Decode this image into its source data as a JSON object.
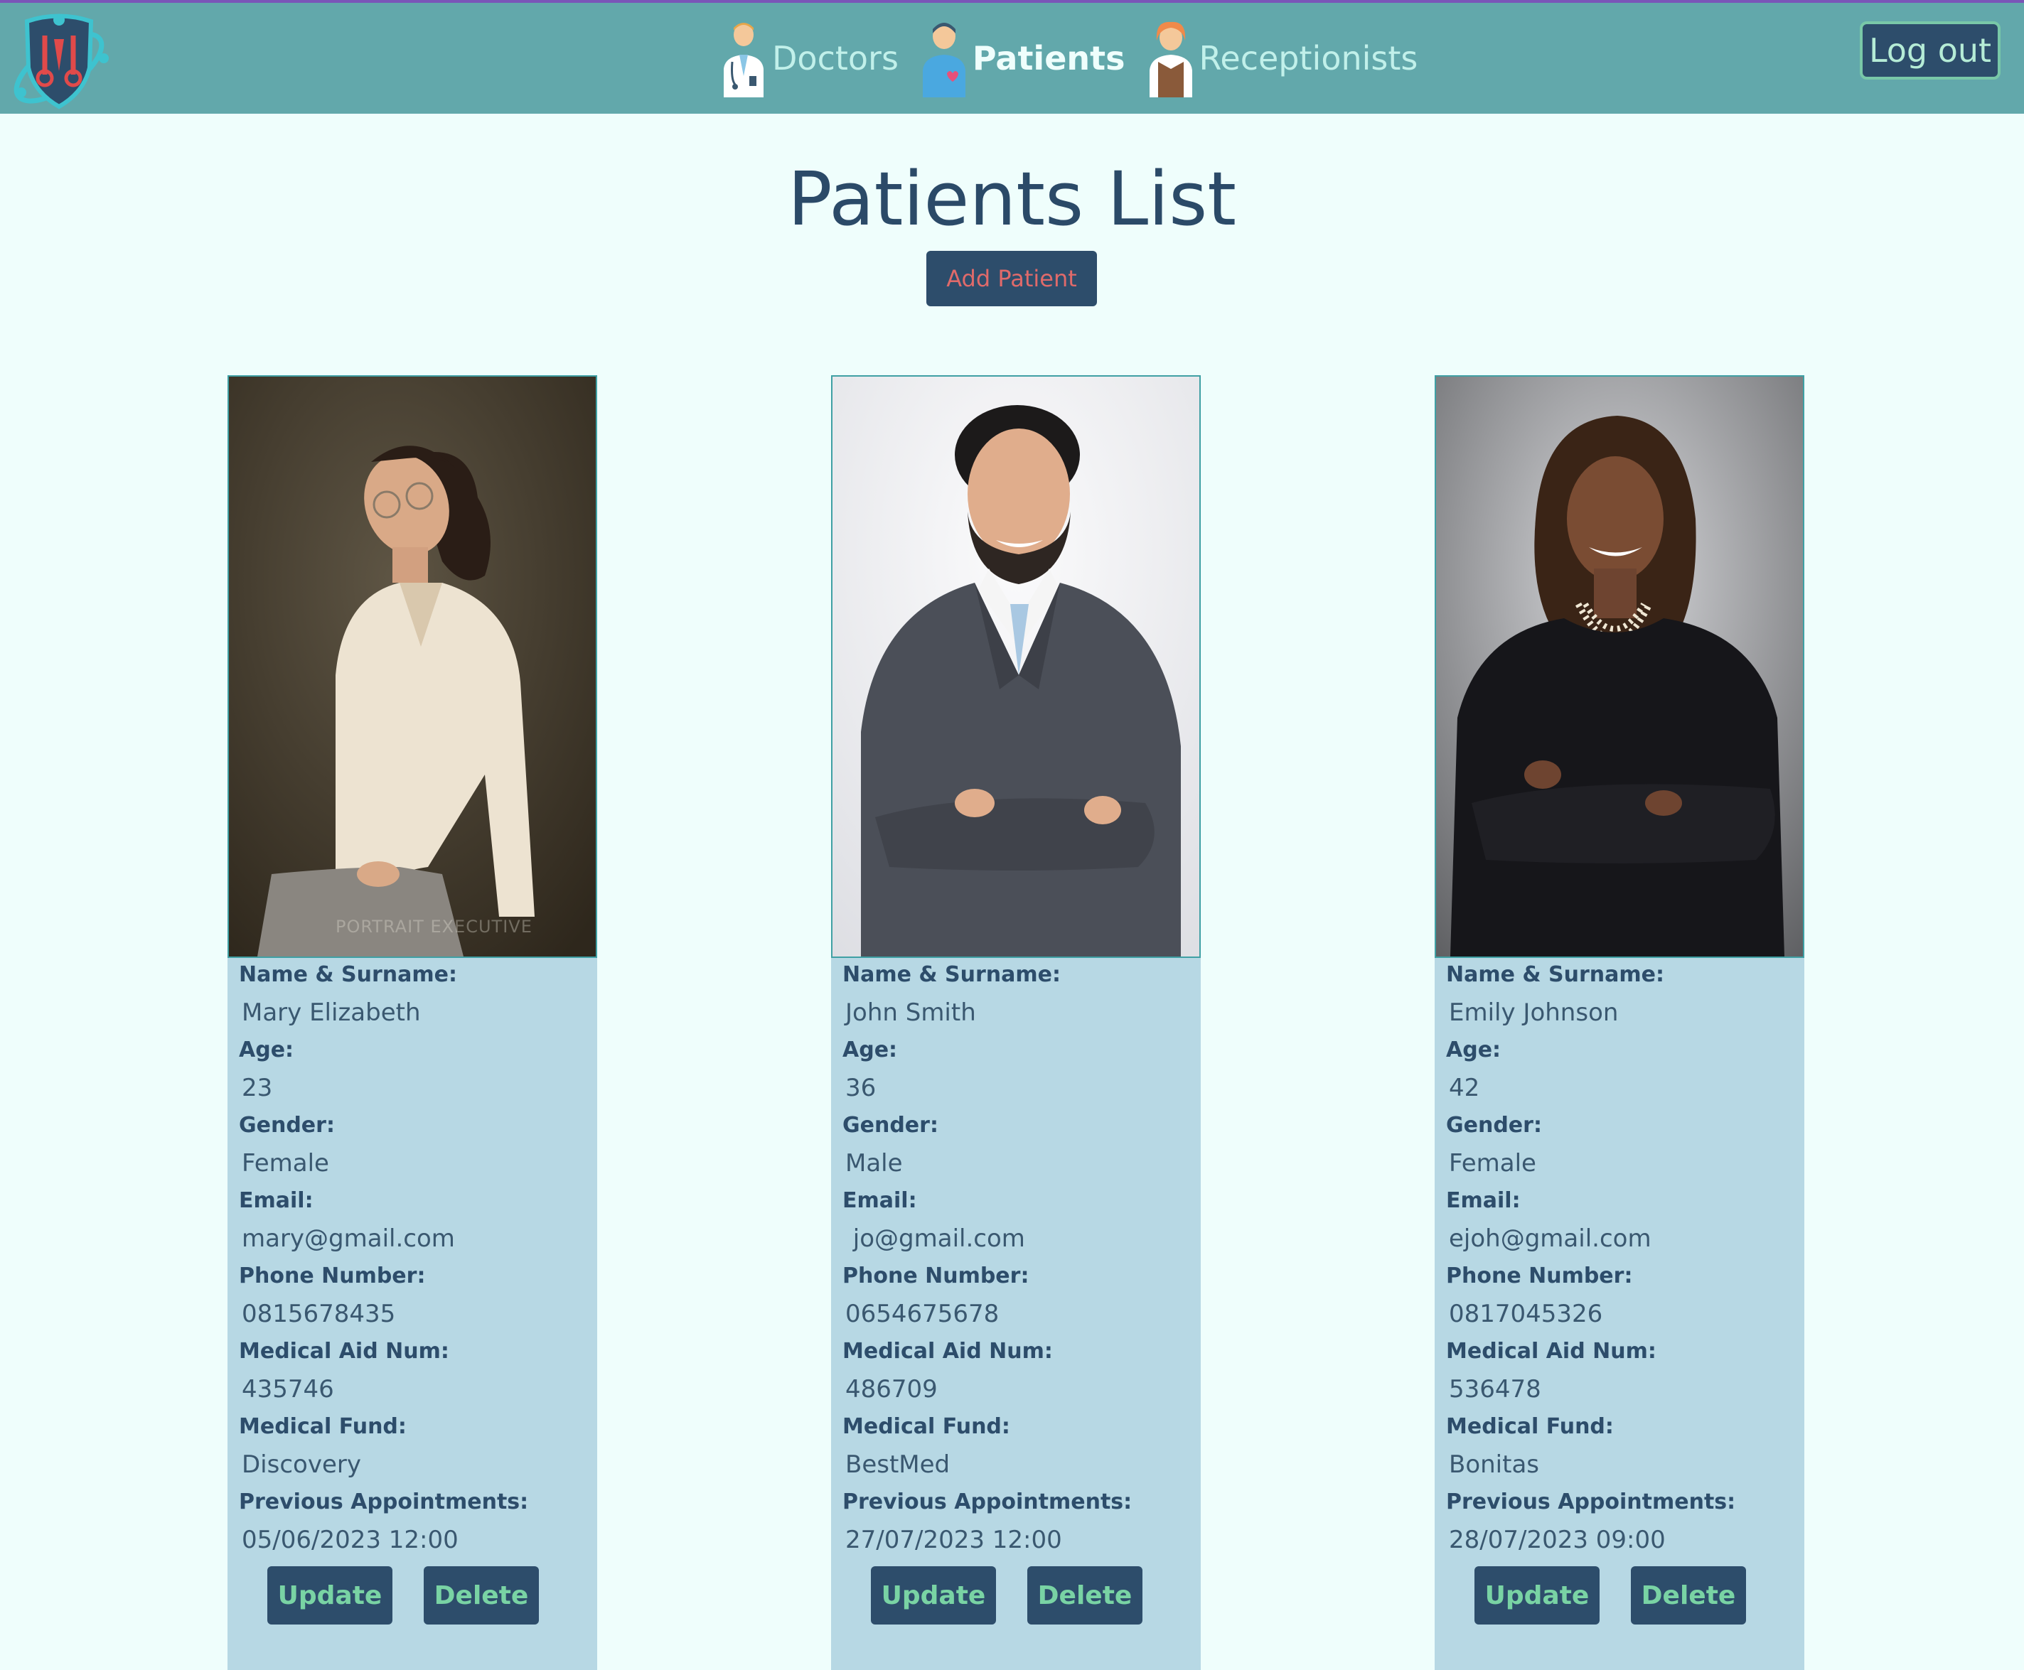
{
  "header": {
    "nav": [
      {
        "label": "Doctors",
        "icon": "doctor-icon",
        "active": false
      },
      {
        "label": "Patients",
        "icon": "patient-icon",
        "active": true
      },
      {
        "label": "Receptionists",
        "icon": "receptionist-icon",
        "active": false
      }
    ],
    "logout_label": "Log out"
  },
  "main": {
    "title": "Patients List",
    "add_label": "Add Patient"
  },
  "field_labels": {
    "name": "Name & Surname:",
    "age": "Age:",
    "gender": "Gender:",
    "email": "Email:",
    "phone": "Phone Number:",
    "medical_aid": "Medical Aid Num:",
    "medical_fund": "Medical Fund:",
    "prev_appointments": "Previous Appointments:"
  },
  "patients": [
    {
      "name": "Mary Elizabeth",
      "age": "23",
      "gender": "Female",
      "email": "mary@gmail.com",
      "phone": "0815678435",
      "medical_aid": "435746",
      "medical_fund": "Discovery",
      "prev_appointments": "05/06/2023 12:00",
      "photo_watermark": "PORTRAIT EXECUTIVE"
    },
    {
      "name": "John Smith",
      "age": "36",
      "gender": "Male",
      "email": " jo@gmail.com",
      "phone": "0654675678",
      "medical_aid": "486709",
      "medical_fund": "BestMed",
      "prev_appointments": "27/07/2023 12:00"
    },
    {
      "name": "Emily Johnson",
      "age": "42",
      "gender": "Female",
      "email": "ejoh@gmail.com",
      "phone": "0817045326",
      "medical_aid": "536478",
      "medical_fund": "Bonitas",
      "prev_appointments": "28/07/2023 09:00"
    }
  ],
  "actions": {
    "update_label": "Update",
    "delete_label": "Delete"
  },
  "colors": {
    "header_bg": "#62a8ab",
    "page_bg": "#effefc",
    "card_bg": "#b7d8e4",
    "button_bg": "#2d4d6b",
    "button_text": "#79d3a4",
    "add_text": "#e06a6a",
    "title": "#2b4a68"
  }
}
